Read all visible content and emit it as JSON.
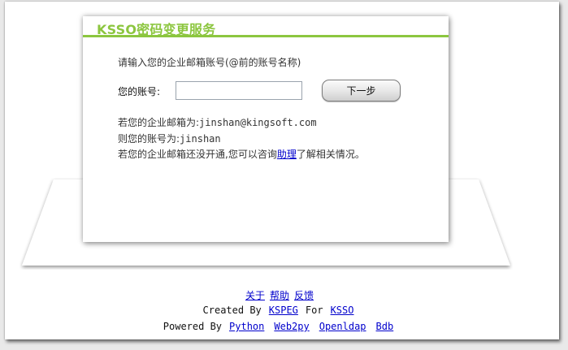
{
  "card": {
    "title": "KSSO密码变更服务",
    "prompt": "请输入您的企业邮箱账号(@前的账号名称)",
    "account_label": "您的账号:",
    "account_value": "",
    "next_button": "下一步",
    "info": {
      "line1_prefix": "若您的企业邮箱为:",
      "line1_value": "jinshan@kingsoft.com",
      "line2_prefix": "则您的账号为:",
      "line2_value": "jinshan",
      "line3_before": "若您的企业邮箱还没开通,您可以咨询",
      "line3_link": "助理",
      "line3_after": "了解相关情况。"
    }
  },
  "footer": {
    "links": [
      "关于",
      "帮助",
      "反馈"
    ],
    "created_by_label": "Created By",
    "created_by_link": "KSPEG",
    "for_label": "For",
    "for_link": "KSSO",
    "powered_by_label": "Powered By",
    "powered_links": [
      "Python",
      "Web2py",
      "Openldap",
      "Bdb"
    ]
  },
  "colors": {
    "accent": "#8cc63f",
    "link": "#0000cc",
    "background": "#e9e9e9"
  }
}
